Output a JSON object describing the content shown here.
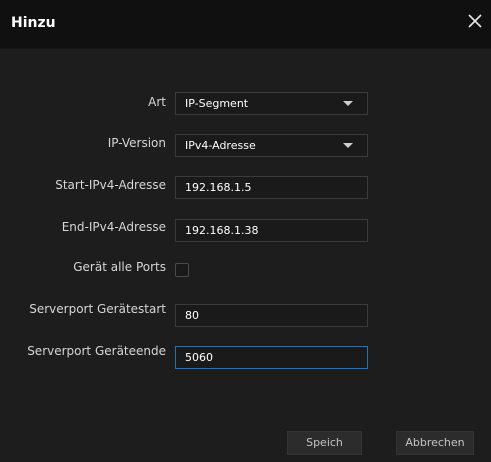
{
  "dialog": {
    "title": "Hinzu"
  },
  "form": {
    "art": {
      "label": "Art",
      "value": "IP-Segment"
    },
    "ip_version": {
      "label": "IP-Version",
      "value": "IPv4-Adresse"
    },
    "start_ip": {
      "label": "Start-IPv4-Adresse",
      "value": "192.168.1.5"
    },
    "end_ip": {
      "label": "End-IPv4-Adresse",
      "value": "192.168.1.38"
    },
    "all_ports": {
      "label": "Gerät alle Ports",
      "checked": false
    },
    "port_start": {
      "label": "Serverport Gerätestart",
      "value": "80"
    },
    "port_end": {
      "label": "Serverport Geräteende",
      "value": "5060"
    }
  },
  "buttons": {
    "save_label": "Speich",
    "cancel_label": "Abbrechen"
  },
  "icons": {
    "close": "close-icon",
    "dropdown": "chevron-down-icon"
  },
  "colors": {
    "background": "#1d1d1d",
    "titlebar": "#101010",
    "focus_border": "#2f6fa3",
    "label_text": "#d6d6d6"
  }
}
